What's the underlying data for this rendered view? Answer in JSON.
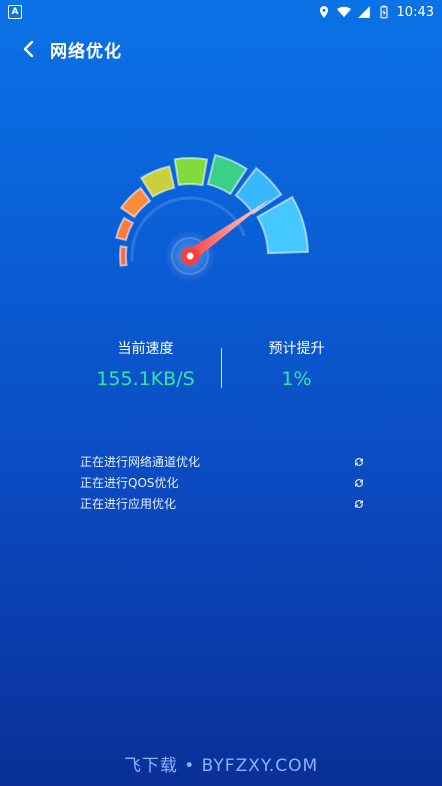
{
  "status_bar": {
    "time": "10:43",
    "left_badge": "A"
  },
  "header": {
    "title": "网络优化"
  },
  "gauge": {
    "level": 0.82
  },
  "stats": {
    "current_speed_label": "当前速度",
    "current_speed_value": "155.1KB/S",
    "expected_boost_label": "预计提升",
    "expected_boost_value": "1%"
  },
  "tasks": [
    {
      "label": "正在进行网络通道优化"
    },
    {
      "label": "正在进行QOS优化"
    },
    {
      "label": "正在进行应用优化"
    }
  ],
  "watermark": "飞下载 • BYFZXY.COM",
  "colors": {
    "accent_green": "#2ee6a8",
    "gauge_red": "#ff3a3a"
  }
}
